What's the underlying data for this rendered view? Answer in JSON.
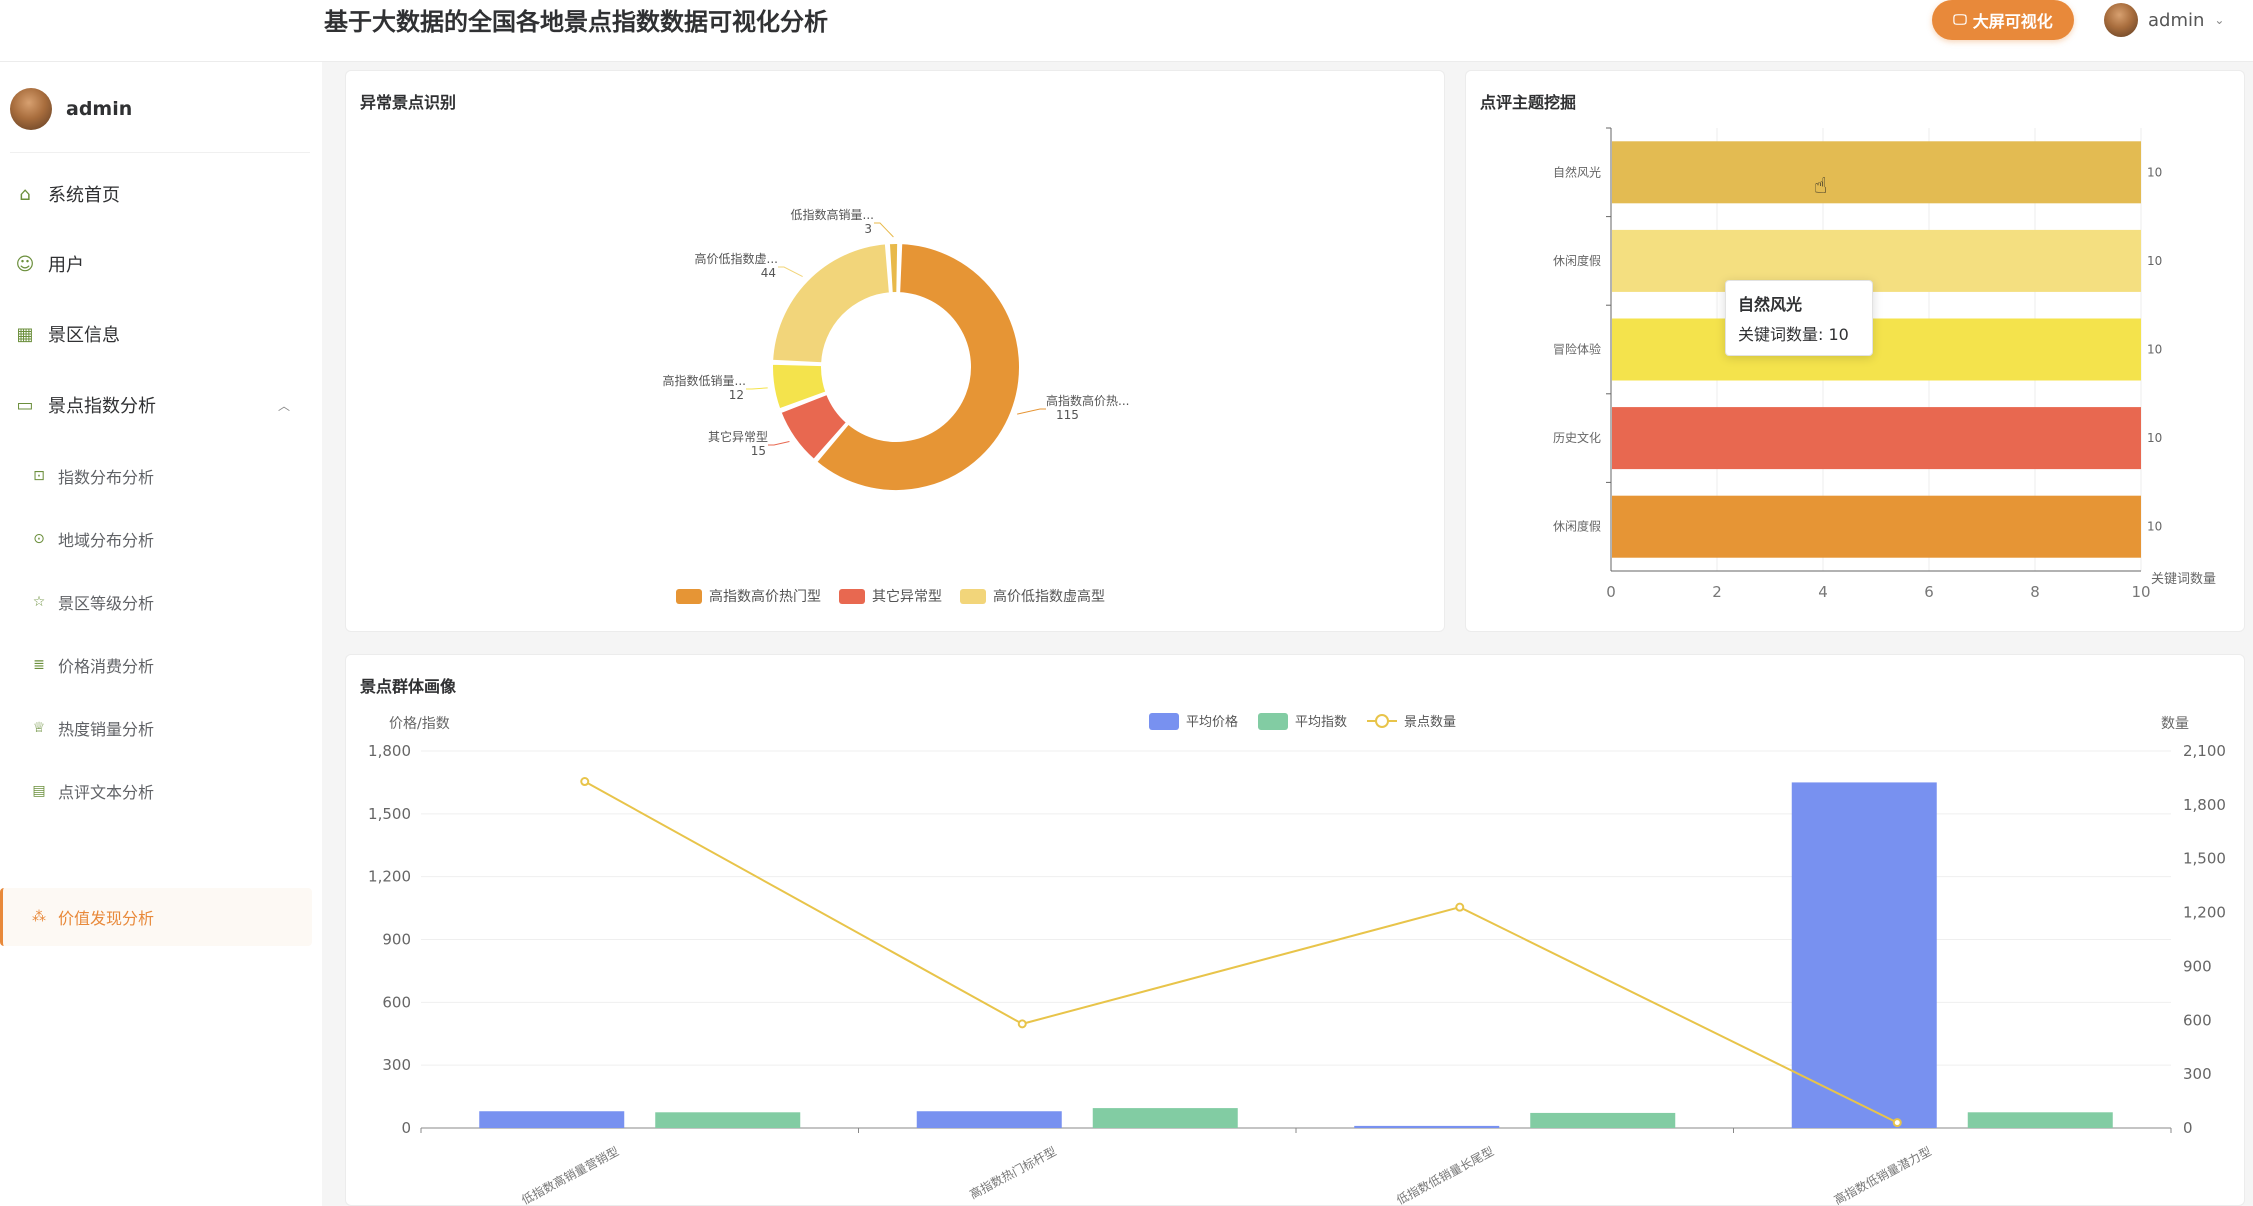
{
  "header": {
    "title": "基于大数据的全国各地景点指数数据可视化分析",
    "big_screen_label": "大屏可视化",
    "user_name": "admin"
  },
  "sidebar": {
    "user_name": "admin",
    "items": [
      {
        "label": "系统首页",
        "icon": "home-icon"
      },
      {
        "label": "用户",
        "icon": "user-icon"
      },
      {
        "label": "景区信息",
        "icon": "grid-icon"
      },
      {
        "label": "景点指数分析",
        "icon": "folder-icon"
      }
    ],
    "sub_items": [
      {
        "label": "指数分布分析",
        "icon": "chart-icon"
      },
      {
        "label": "地域分布分析",
        "icon": "location-icon"
      },
      {
        "label": "景区等级分析",
        "icon": "star-icon"
      },
      {
        "label": "价格消费分析",
        "icon": "coins-icon"
      },
      {
        "label": "热度销量分析",
        "icon": "trophy-icon"
      },
      {
        "label": "点评文本分析",
        "icon": "comment-icon"
      },
      {
        "label": "价值发现分析",
        "icon": "sparkle-icon"
      }
    ]
  },
  "panels": {
    "p1_title": "异常景点识别",
    "p2_title": "点评主题挖掘",
    "p3_title": "景点群体画像"
  },
  "tooltip": {
    "title": "自然风光",
    "row": "关键词数量:  10"
  },
  "chart_data": [
    {
      "type": "pie",
      "donut": true,
      "slices": [
        {
          "label": "高指数高价热...",
          "value": 115,
          "color": "#e69535"
        },
        {
          "label": "其它异常型",
          "value": 15,
          "color": "#e86850"
        },
        {
          "label": "高指数低销量...",
          "value": 12,
          "color": "#f4e34c"
        },
        {
          "label": "高价低指数虚...",
          "value": 44,
          "color": "#f2d57a"
        },
        {
          "label": "低指数高销量...",
          "value": 3,
          "color": "#e8b94a"
        }
      ],
      "legend": [
        "高指数高价热门型",
        "其它异常型",
        "高价低指数虚高型"
      ],
      "legend_colors": [
        "#e69535",
        "#e86850",
        "#f2d57a"
      ],
      "legend_position": "bottom"
    },
    {
      "type": "bar",
      "orientation": "horizontal",
      "categories": [
        "自然风光",
        "休闲度假",
        "冒险体验",
        "历史文化",
        "休闲度假"
      ],
      "values": [
        10,
        10,
        10,
        10,
        10
      ],
      "colors": [
        "#e3bb52",
        "#f4df80",
        "#f4e34c",
        "#e86850",
        "#e69535"
      ],
      "xlabel": "关键词数量",
      "xlim": [
        0,
        10
      ],
      "xticks": [
        0,
        2,
        4,
        6,
        8,
        10
      ]
    },
    {
      "type": "bar",
      "categories": [
        "低指数高销量营销型",
        "高指数热门标杆型",
        "低指数低销量长尾型",
        "高指数低销量潜力型"
      ],
      "series": [
        {
          "name": "平均价格",
          "type": "bar",
          "axis": "left",
          "values": [
            80,
            80,
            10,
            1650
          ],
          "color": "#7891f0"
        },
        {
          "name": "平均指数",
          "type": "bar",
          "axis": "left",
          "values": [
            75,
            95,
            72,
            75
          ],
          "color": "#82cca3"
        },
        {
          "name": "景点数量",
          "type": "line",
          "axis": "right",
          "values": [
            1930,
            580,
            1230,
            30
          ],
          "color": "#e8c44a"
        }
      ],
      "ylabel_left": "价格/指数",
      "ylabel_right": "数量",
      "ylim_left": [
        0,
        1800
      ],
      "yticks_left": [
        "1,800",
        "1,500",
        "1,200",
        "900",
        "600",
        "300",
        "0"
      ],
      "ylim_right": [
        0,
        2100
      ],
      "yticks_right": [
        "2,100",
        "1,800",
        "1,500",
        "1,200",
        "900",
        "600",
        "300",
        "0"
      ],
      "legend_position": "top-center"
    }
  ]
}
